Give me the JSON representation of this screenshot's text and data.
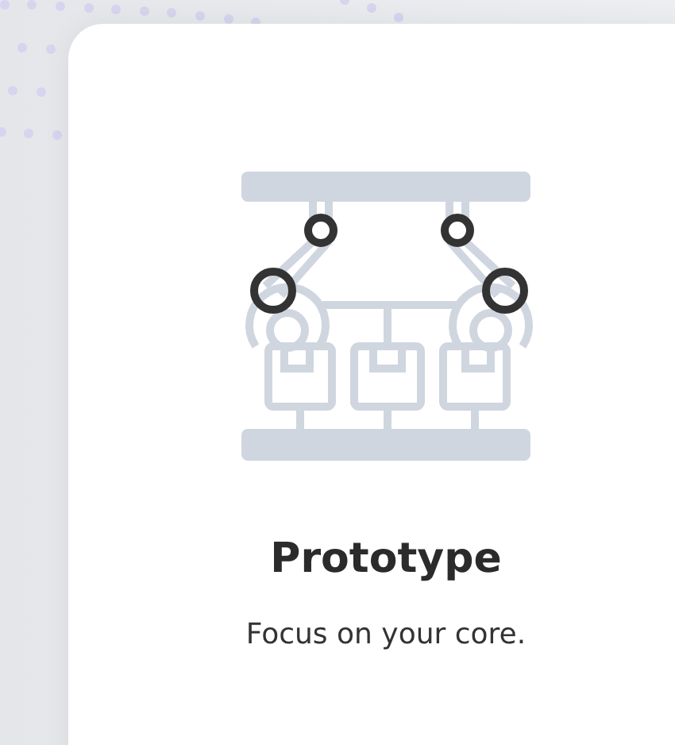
{
  "card": {
    "title": "Prototype",
    "subtitle": "Focus on your core."
  }
}
